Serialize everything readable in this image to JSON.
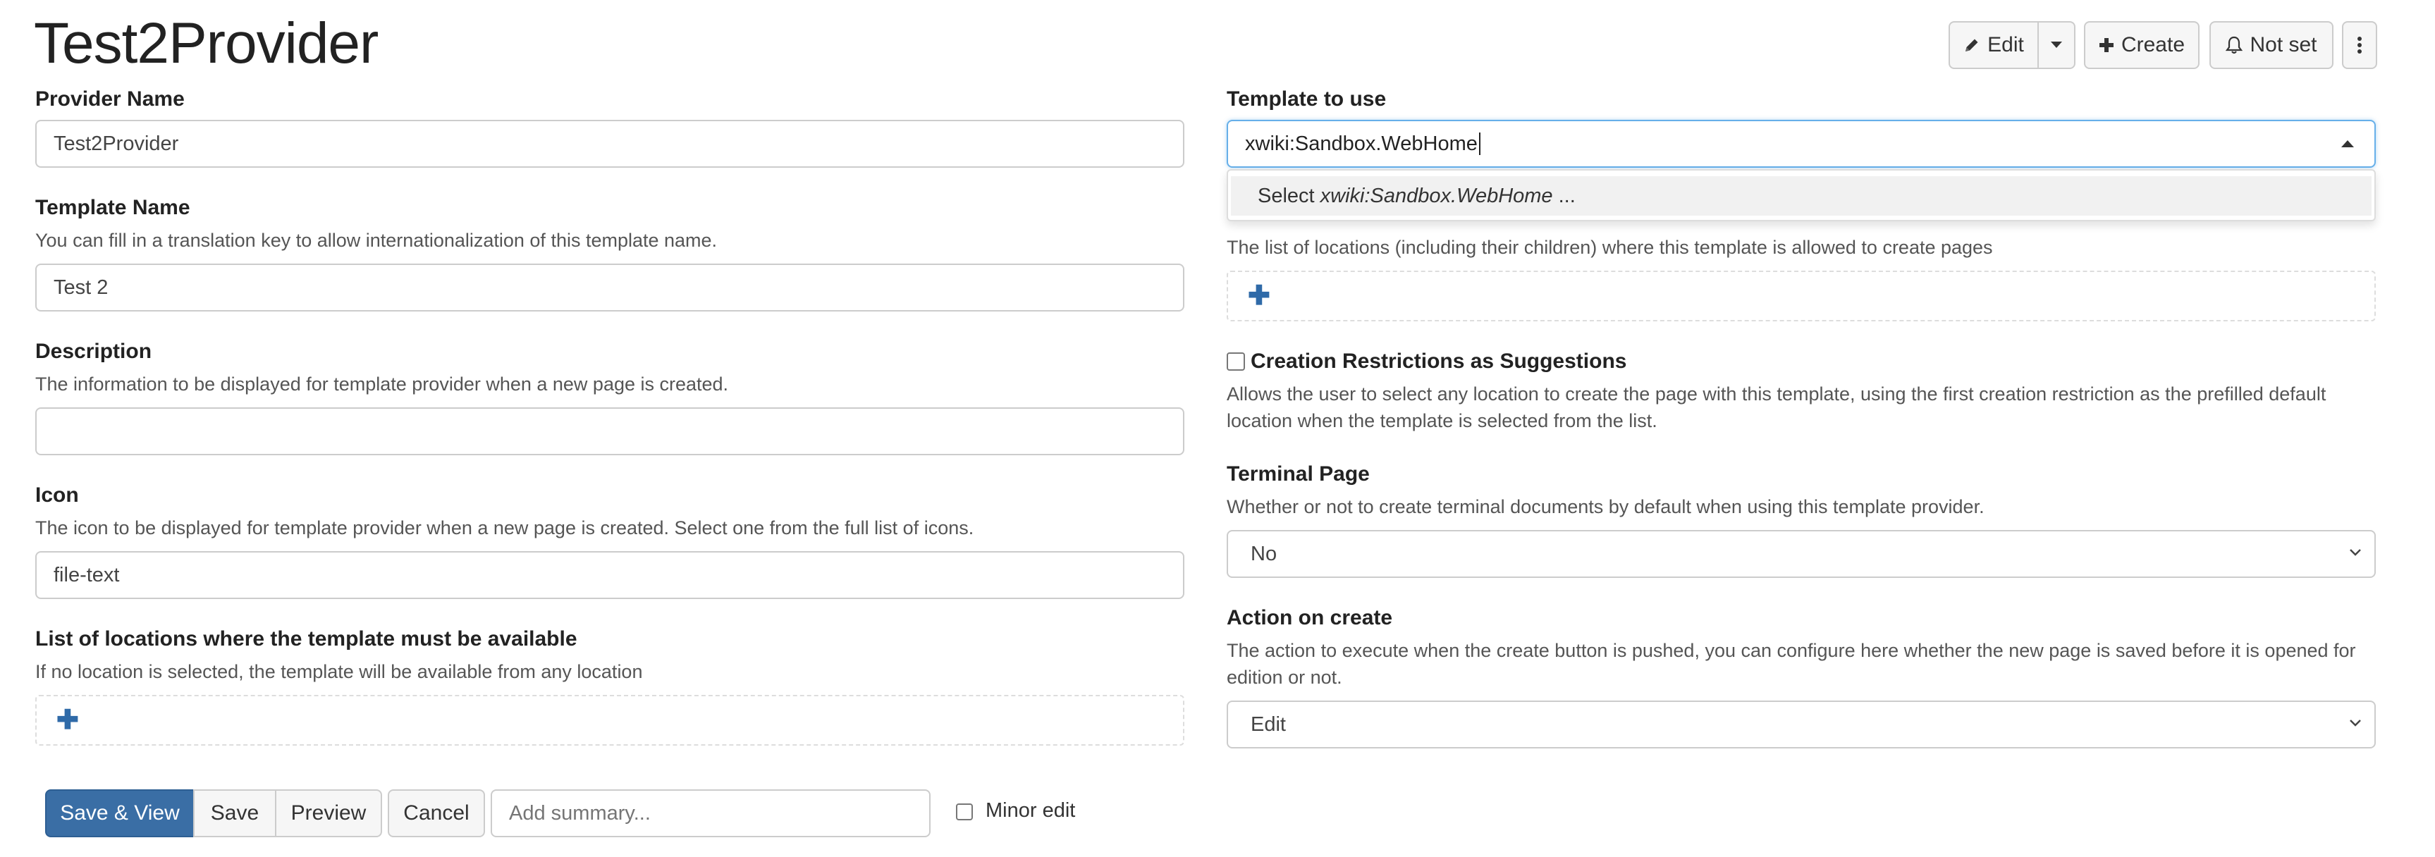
{
  "page": {
    "title": "Test2Provider"
  },
  "toolbar": {
    "edit_label": "Edit",
    "create_label": "Create",
    "notify_label": "Not set"
  },
  "left": {
    "provider_name": {
      "label": "Provider Name",
      "value": "Test2Provider"
    },
    "template_name": {
      "label": "Template Name",
      "hint": "You can fill in a translation key to allow internationalization of this template name.",
      "value": "Test 2"
    },
    "description": {
      "label": "Description",
      "hint": "The information to be displayed for template provider when a new page is created.",
      "value": ""
    },
    "icon": {
      "label": "Icon",
      "hint": "The icon to be displayed for template provider when a new page is created. Select one from the full list of icons.",
      "value": "file-text"
    },
    "locations": {
      "label": "List of locations where the template must be available",
      "hint": "If no location is selected, the template will be available from any location"
    }
  },
  "right": {
    "template_to_use": {
      "label": "Template to use",
      "value": "xwiki:Sandbox.WebHome",
      "suggestion_prefix": "Select ",
      "suggestion_value": "xwiki:Sandbox.WebHome",
      "suggestion_suffix": " ..."
    },
    "creation_restrictions": {
      "hint": "The list of locations (including their children) where this template is allowed to create pages"
    },
    "restrictions_as_suggestions": {
      "label": "Creation Restrictions as Suggestions",
      "checked": false,
      "hint": "Allows the user to select any location to create the page with this template, using the first creation restriction as the prefilled default location when the template is selected from the list."
    },
    "terminal_page": {
      "label": "Terminal Page",
      "hint": "Whether or not to create terminal documents by default when using this template provider.",
      "value": "No"
    },
    "action_on_create": {
      "label": "Action on create",
      "hint": "The action to execute when the create button is pushed, you can configure here whether the new page is saved before it is opened for edition or not.",
      "value": "Edit"
    }
  },
  "bottom": {
    "save_view_label": "Save & View",
    "save_label": "Save",
    "preview_label": "Preview",
    "cancel_label": "Cancel",
    "summary_placeholder": "Add summary...",
    "minor_edit_label": "Minor edit",
    "minor_edit_checked": false
  },
  "colors": {
    "primary": "#3a6ea5",
    "plus_icon": "#2f6aa8",
    "focus_border": "#66afe9"
  }
}
